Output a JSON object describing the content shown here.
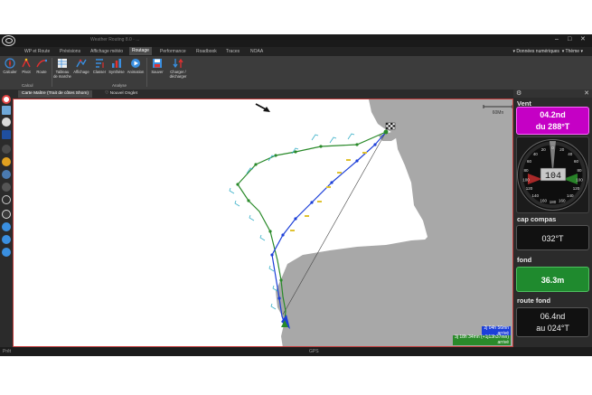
{
  "window": {
    "title": "Weather Routing 8.0 · ...",
    "min": "–",
    "max": "□",
    "close": "✕"
  },
  "tabs": [
    {
      "label": "WP et Route",
      "active": false
    },
    {
      "label": "Prévisions",
      "active": false
    },
    {
      "label": "Affichage météo",
      "active": false
    },
    {
      "label": "Routage",
      "active": true
    },
    {
      "label": "Performance",
      "active": false
    },
    {
      "label": "Roadbook",
      "active": false
    },
    {
      "label": "Traces",
      "active": false
    },
    {
      "label": "NOAA",
      "active": false
    }
  ],
  "tabbar_right": {
    "donnees": "Données numériques",
    "theme": "Thème"
  },
  "ribbon": {
    "buttons": [
      {
        "label": "Calculer",
        "icon": "compass-rose-icon"
      },
      {
        "label": "Pivot",
        "icon": "pivot-icon"
      },
      {
        "label": "Route",
        "icon": "route-icon"
      },
      {
        "label": "Tableau de marche",
        "icon": "table-icon"
      },
      {
        "label": "Affichage",
        "icon": "display-icon"
      },
      {
        "label": "Classer",
        "icon": "sort-icon"
      },
      {
        "label": "Synthèse",
        "icon": "summary-icon"
      },
      {
        "label": "Animation",
        "icon": "animation-icon"
      },
      {
        "label": "Sauver",
        "icon": "save-icon"
      },
      {
        "label": "Charger / décharger",
        "icon": "load-icon"
      }
    ],
    "groups": {
      "calcul": "Calcul",
      "analyse": "Analyse"
    }
  },
  "doc_tabs": {
    "main": "Carte Maître (Trait de côtes Shom)",
    "new": "Nouvel Onglet"
  },
  "map": {
    "scale_label": "60Mn",
    "route_blue": {
      "line1": "2j 04h 56mn",
      "line2": "arrivé"
    },
    "route_green": {
      "line1": "3j 18h 34mn (+1j13h37mn)",
      "line2": "arrivé"
    }
  },
  "panel": {
    "vent_label": "Vent",
    "vent_speed": "04.2nd",
    "vent_dir": "du 288°T",
    "gauge_readout": "104",
    "gauge_ticks": [
      "0",
      "20",
      "40",
      "60",
      "80",
      "100",
      "120",
      "140",
      "160",
      "180",
      "160",
      "140",
      "120",
      "100",
      "80",
      "60",
      "40",
      "20"
    ],
    "compas_label": "cap compas",
    "compas_value": "032°T",
    "fond_label": "fond",
    "fond_value": "36.3m",
    "routefond_label": "route fond",
    "routefond_speed": "06.4nd",
    "routefond_dir": "au 024°T"
  },
  "status": {
    "left": "Prêt",
    "mid": "GPS"
  },
  "colors": {
    "accent_magenta": "#c500c5",
    "depth_green": "#1f8a2e",
    "route_blue": "#1c3fd8",
    "route_green": "#2a8a2a",
    "land_gray": "#a8a8a8",
    "map_border": "#c23b3b"
  }
}
